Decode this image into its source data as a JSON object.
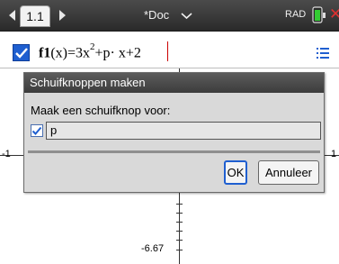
{
  "topbar": {
    "tab_label": "1.1",
    "doc_title": "*Doc",
    "angle_mode": "RAD",
    "icons": [
      "nav-left-icon",
      "nav-right-icon",
      "chevron-down-icon",
      "battery-icon",
      "close-icon"
    ]
  },
  "function_bar": {
    "name": "f1",
    "arg": "(x)=3x",
    "exp": "2",
    "rest": "+p· x+2",
    "checked": true,
    "colors": {
      "checkbox": "#1f5fd0",
      "cursor": "#cc0000"
    }
  },
  "graph": {
    "x_min_label": "-1",
    "x_max_label": "1",
    "y_min_label": "-6.67"
  },
  "dialog": {
    "title": "Schuifknoppen maken",
    "prompt": "Maak een schuifknop voor:",
    "variable": "p",
    "variable_checked": true,
    "ok_label": "OK",
    "cancel_label": "Annuleer"
  }
}
